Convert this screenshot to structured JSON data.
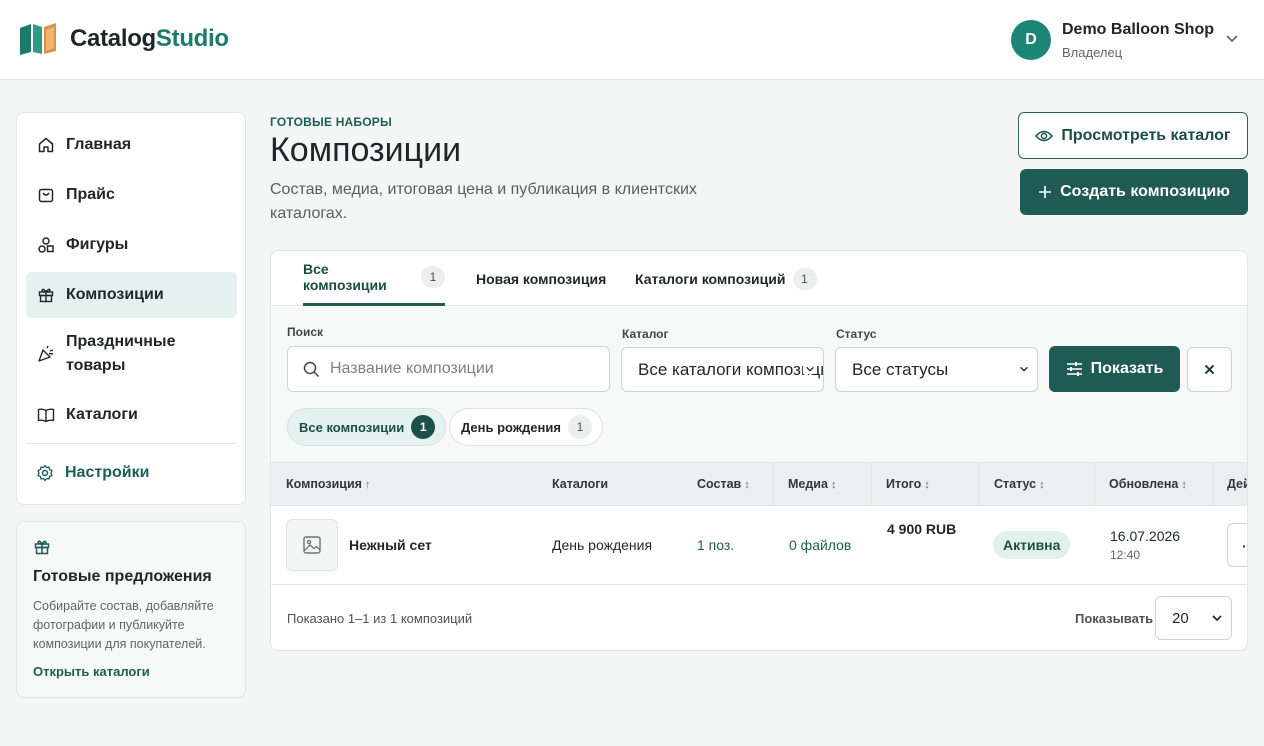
{
  "brand": {
    "name_part1": "Catalog",
    "name_part2": "Studio",
    "accent": "#1d7b6c"
  },
  "account": {
    "initial": "D",
    "name": "Demo Balloon Shop",
    "role": "Владелец"
  },
  "sidebar": {
    "items": [
      {
        "label": "Главная",
        "icon": "home-icon"
      },
      {
        "label": "Прайс",
        "icon": "price-bag-icon"
      },
      {
        "label": "Фигуры",
        "icon": "shapes-icon"
      },
      {
        "label": "Композиции",
        "icon": "gift-icon",
        "active": true
      },
      {
        "label": "Праздничные товары",
        "icon": "party-popper-icon"
      },
      {
        "label": "Каталоги",
        "icon": "book-icon"
      },
      {
        "label": "Настройки",
        "icon": "gear-icon"
      }
    ]
  },
  "promo": {
    "title": "Готовые предложения",
    "description": "Собирайте состав, добавляйте фотографии и публикуйте композиции для покупателей.",
    "link": "Открыть каталоги"
  },
  "page": {
    "eyebrow": "ГОТОВЫЕ НАБОРЫ",
    "title": "Композиции",
    "subtitle": "Состав, медиа, итоговая цена и публикация в клиентских каталогах.",
    "view_catalog_label": "Просмотреть каталог",
    "create_label": "Создать композицию"
  },
  "tabs": [
    {
      "label": "Все композиции",
      "count": "1",
      "active": true
    },
    {
      "label": "Новая композиция"
    },
    {
      "label": "Каталоги композиций",
      "count": "1"
    }
  ],
  "filters": {
    "search_label": "Поиск",
    "search_placeholder": "Название композиции",
    "catalog_label": "Каталог",
    "catalog_value": "Все каталоги композиций",
    "status_label": "Статус",
    "status_value": "Все статусы",
    "show_label": "Показать",
    "chips": [
      {
        "label": "Все композиции",
        "count": "1",
        "active": true
      },
      {
        "label": "День рождения",
        "count": "1"
      }
    ]
  },
  "table": {
    "columns": [
      {
        "label": "Композиция",
        "sort": "↑"
      },
      {
        "label": "Каталоги",
        "sort": ""
      },
      {
        "label": "Состав",
        "sort": "↕"
      },
      {
        "label": "Медиа",
        "sort": "↕"
      },
      {
        "label": "Итого",
        "sort": "↕"
      },
      {
        "label": "Статус",
        "sort": "↕"
      },
      {
        "label": "Обновлена",
        "sort": "↕"
      },
      {
        "label": "Действия",
        "sort": ""
      }
    ],
    "rows": [
      {
        "name": "Нежный сет",
        "catalogs": "День рождения",
        "composition": "1 поз.",
        "media": "0 файлов",
        "total": "4 900 RUB",
        "status": "Активна",
        "updated_date": "16.07.2026",
        "updated_time": "12:40",
        "actions": "···"
      }
    ]
  },
  "pagination": {
    "summary": "Показано 1–1 из 1 композиций",
    "per_page_label": "Показывать",
    "per_page_value": "20"
  }
}
